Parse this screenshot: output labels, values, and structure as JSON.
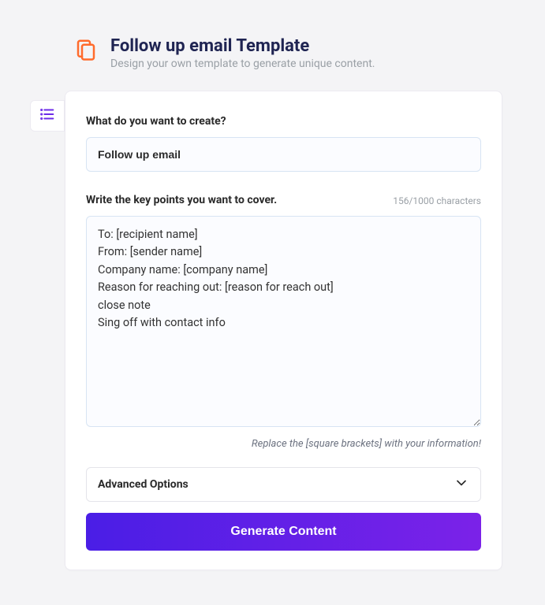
{
  "header": {
    "title": "Follow up email Template",
    "subtitle": "Design your own template to generate unique content."
  },
  "form": {
    "create_label": "What do you want to create?",
    "create_value": "Follow up email",
    "keypoints_label": "Write the key points you want to cover.",
    "char_count": "156/1000 characters",
    "keypoints_value": "To: [recipient name]\nFrom: [sender name]\nCompany name: [company name]\nReason for reaching out: [reason for reach out]\nclose note\nSing off with contact info",
    "hint": "Replace the [square brackets] with your information!",
    "advanced_label": "Advanced Options",
    "generate_label": "Generate Content"
  }
}
